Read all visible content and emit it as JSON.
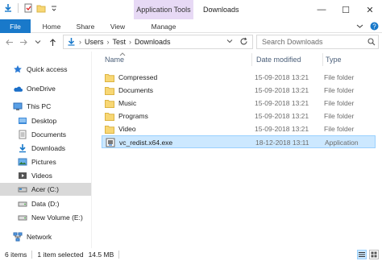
{
  "titlebar": {
    "context_tab_title": "Application Tools",
    "window_title": "Downloads",
    "minimize": "—",
    "maximize": "☐",
    "close": "✕"
  },
  "ribbon": {
    "tabs": [
      "File",
      "Home",
      "Share",
      "View",
      "Manage"
    ],
    "accent": "#1979ca",
    "context_color": "#e7d9f5"
  },
  "address": {
    "crumbs": [
      "Users",
      "Test",
      "Downloads"
    ],
    "search_placeholder": "Search Downloads"
  },
  "navpane": {
    "items": [
      {
        "label": "Quick access",
        "icon": "star-icon"
      },
      {
        "label": "OneDrive",
        "icon": "cloud-icon"
      },
      {
        "label": "This PC",
        "icon": "computer-icon"
      },
      {
        "label": "Desktop",
        "icon": "desktop-folder-icon"
      },
      {
        "label": "Documents",
        "icon": "documents-folder-icon"
      },
      {
        "label": "Downloads",
        "icon": "downloads-folder-icon"
      },
      {
        "label": "Pictures",
        "icon": "pictures-folder-icon"
      },
      {
        "label": "Videos",
        "icon": "videos-folder-icon"
      },
      {
        "label": "Acer (C:)",
        "icon": "drive-icon"
      },
      {
        "label": "Data (D:)",
        "icon": "drive-icon"
      },
      {
        "label": "New Volume (E:)",
        "icon": "drive-icon"
      },
      {
        "label": "Network",
        "icon": "network-icon"
      }
    ]
  },
  "filelist": {
    "columns": [
      "Name",
      "Date modified",
      "Type"
    ],
    "rows": [
      {
        "name": "Compressed",
        "date": "15-09-2018 13:21",
        "type": "File folder",
        "icon": "folder-icon"
      },
      {
        "name": "Documents",
        "date": "15-09-2018 13:21",
        "type": "File folder",
        "icon": "folder-icon"
      },
      {
        "name": "Music",
        "date": "15-09-2018 13:21",
        "type": "File folder",
        "icon": "folder-icon"
      },
      {
        "name": "Programs",
        "date": "15-09-2018 13:21",
        "type": "File folder",
        "icon": "folder-icon"
      },
      {
        "name": "Video",
        "date": "15-09-2018 13:21",
        "type": "File folder",
        "icon": "folder-icon"
      },
      {
        "name": "vc_redist.x64.exe",
        "date": "18-12-2018 13:11",
        "type": "Application",
        "icon": "installer-icon"
      }
    ]
  },
  "status": {
    "items_count": "6 items",
    "selection": "1 item selected",
    "size": "14.5 MB"
  }
}
